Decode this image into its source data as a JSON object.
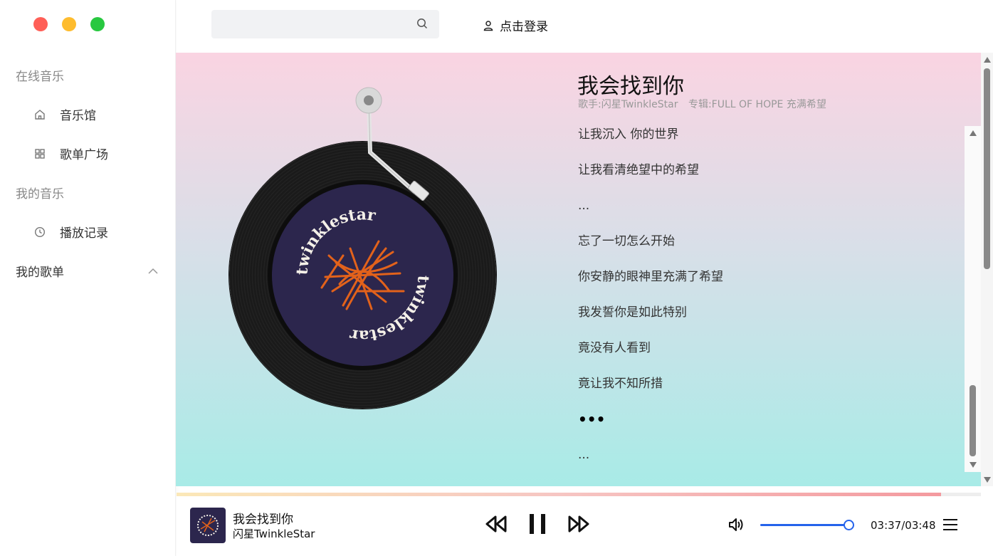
{
  "sidebar": {
    "sections": {
      "online": "在线音乐",
      "mine": "我的音乐"
    },
    "items": [
      {
        "label": "音乐馆",
        "icon": "home-icon"
      },
      {
        "label": "歌单广场",
        "icon": "grid-icon"
      },
      {
        "label": "播放记录",
        "icon": "clock-icon"
      }
    ],
    "playlists_label": "我的歌单"
  },
  "header": {
    "search_placeholder": "",
    "login_label": "点击登录"
  },
  "song": {
    "title": "我会找到你",
    "artist_label": "歌手:闪星TwinkleStar",
    "album_label": "专辑:FULL OF HOPE 充满希望",
    "cover_text": "twinklestar"
  },
  "lyrics": [
    "让我沉入 你的世界",
    "让我看清绝望中的希望",
    "...",
    "忘了一切怎么开始",
    "你安静的眼神里充满了希望",
    "我发誓你是如此特别",
    "竟没有人看到",
    "竟让我不知所措",
    "•••",
    "..."
  ],
  "player": {
    "title": "我会找到你",
    "artist": "闪星TwinkleStar",
    "time": "03:37/03:48",
    "progress": 0.95,
    "volume": 1.0
  },
  "colors": {
    "accent": "#2563eb",
    "bg_top": "#fad4e2",
    "bg_bottom": "#a8ebe7"
  }
}
